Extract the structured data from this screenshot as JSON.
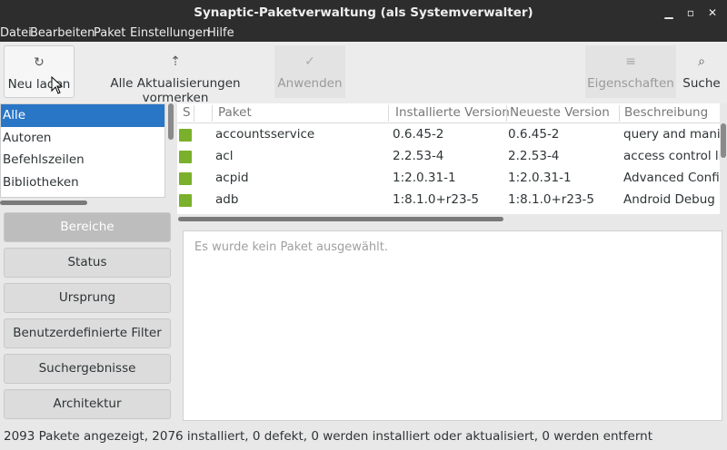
{
  "window": {
    "title": "Synaptic-Paketverwaltung (als Systemverwalter)"
  },
  "menu": [
    "Datei",
    "Bearbeiten",
    "Paket",
    "Einstellungen",
    "Hilfe"
  ],
  "toolbar": {
    "reload": "Neu laden",
    "mark_all": "Alle Aktualisierungen vormerken",
    "apply": "Anwenden",
    "properties": "Eigenschaften",
    "search": "Suche"
  },
  "categories": [
    "Alle",
    "Autoren",
    "Befehlszeilen",
    "Bibliotheken"
  ],
  "filters": [
    "Bereiche",
    "Status",
    "Ursprung",
    "Benutzerdefinierte Filter",
    "Suchergebnisse",
    "Architektur"
  ],
  "columns": [
    "S",
    "Paket",
    "Installierte Version",
    "Neueste Version",
    "Beschreibung"
  ],
  "packages": [
    {
      "name": "accountsservice",
      "installed": "0.6.45-2",
      "latest": "0.6.45-2",
      "desc": "query and manip"
    },
    {
      "name": "acl",
      "installed": "2.2.53-4",
      "latest": "2.2.53-4",
      "desc": "access control li"
    },
    {
      "name": "acpid",
      "installed": "1:2.0.31-1",
      "latest": "1:2.0.31-1",
      "desc": "Advanced Config"
    },
    {
      "name": "adb",
      "installed": "1:8.1.0+r23-5",
      "latest": "1:8.1.0+r23-5",
      "desc": "Android Debug E"
    }
  ],
  "detail": {
    "empty": "Es wurde kein Paket ausgewählt."
  },
  "status": "2093 Pakete angezeigt, 2076 installiert, 0 defekt, 0 werden installiert oder aktualisiert, 0 werden entfernt",
  "colors": {
    "selection": "#2a76c6",
    "installed": "#7ab02c",
    "titlebar": "#2d2d2d"
  }
}
